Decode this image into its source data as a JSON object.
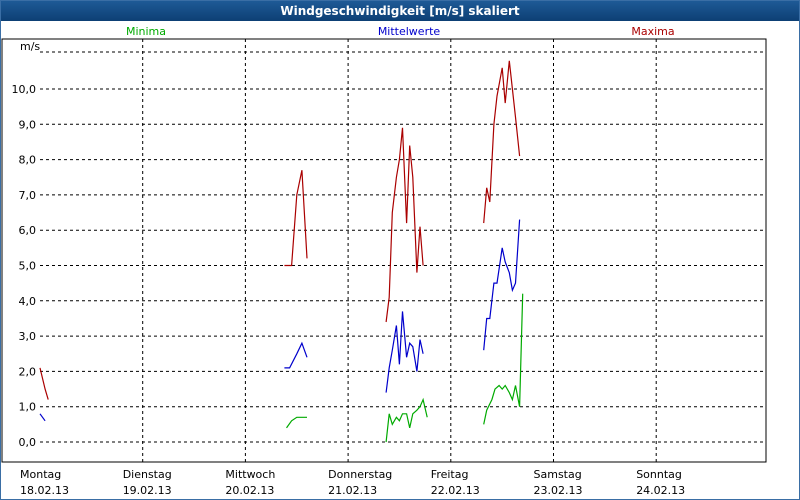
{
  "window": {
    "title": "Windgeschwindigkeit [m/s] skaliert"
  },
  "chart_data": {
    "type": "line",
    "title": "Windgeschwindigkeit [m/s] skaliert",
    "ylabel": "m/s",
    "ylim": [
      -0.6,
      11.2
    ],
    "y_ticks": [
      "0,0",
      "1,0",
      "2,0",
      "3,0",
      "4,0",
      "5,0",
      "6,0",
      "7,0",
      "8,0",
      "9,0",
      "10,0"
    ],
    "x_ticks": [
      {
        "day": "Montag",
        "date": "18.02.13"
      },
      {
        "day": "Dienstag",
        "date": "19.02.13"
      },
      {
        "day": "Mittwoch",
        "date": "20.02.13"
      },
      {
        "day": "Donnerstag",
        "date": "21.02.13"
      },
      {
        "day": "Freitag",
        "date": "22.02.13"
      },
      {
        "day": "Samstag",
        "date": "23.02.13"
      },
      {
        "day": "Sonntag",
        "date": "24.02.13"
      }
    ],
    "grid": true,
    "series": [
      {
        "name": "Minima",
        "color": "#00aa00",
        "segments": [
          [
            [
              2.4,
              0.4
            ],
            [
              2.45,
              0.6
            ],
            [
              2.5,
              0.7
            ],
            [
              2.55,
              0.7
            ],
            [
              2.6,
              0.7
            ]
          ],
          [
            [
              3.37,
              0.0
            ],
            [
              3.4,
              0.8
            ],
            [
              3.43,
              0.5
            ],
            [
              3.47,
              0.7
            ],
            [
              3.5,
              0.6
            ],
            [
              3.53,
              0.8
            ],
            [
              3.57,
              0.8
            ],
            [
              3.6,
              0.4
            ],
            [
              3.63,
              0.8
            ],
            [
              3.67,
              0.9
            ],
            [
              3.7,
              1.0
            ],
            [
              3.73,
              1.2
            ],
            [
              3.77,
              0.7
            ]
          ],
          [
            [
              4.32,
              0.5
            ],
            [
              4.35,
              0.9
            ],
            [
              4.4,
              1.2
            ],
            [
              4.43,
              1.5
            ],
            [
              4.47,
              1.6
            ],
            [
              4.5,
              1.5
            ],
            [
              4.53,
              1.6
            ],
            [
              4.57,
              1.4
            ],
            [
              4.6,
              1.2
            ],
            [
              4.63,
              1.6
            ],
            [
              4.67,
              1.0
            ],
            [
              4.7,
              4.2
            ]
          ]
        ]
      },
      {
        "name": "Mittelwerte",
        "color": "#0000cc",
        "segments": [
          [
            [
              0.0,
              0.8
            ],
            [
              0.05,
              0.6
            ]
          ],
          [
            [
              2.38,
              2.1
            ],
            [
              2.43,
              2.1
            ],
            [
              2.5,
              2.5
            ],
            [
              2.55,
              2.8
            ],
            [
              2.6,
              2.4
            ]
          ],
          [
            [
              3.37,
              1.4
            ],
            [
              3.4,
              2.1
            ],
            [
              3.43,
              2.6
            ],
            [
              3.47,
              3.3
            ],
            [
              3.5,
              2.2
            ],
            [
              3.53,
              3.7
            ],
            [
              3.57,
              2.4
            ],
            [
              3.6,
              2.8
            ],
            [
              3.63,
              2.7
            ],
            [
              3.67,
              2.0
            ],
            [
              3.7,
              2.9
            ],
            [
              3.73,
              2.5
            ]
          ],
          [
            [
              4.32,
              2.6
            ],
            [
              4.35,
              3.5
            ],
            [
              4.38,
              3.5
            ],
            [
              4.42,
              4.5
            ],
            [
              4.45,
              4.5
            ],
            [
              4.5,
              5.5
            ],
            [
              4.53,
              5.1
            ],
            [
              4.57,
              4.8
            ],
            [
              4.6,
              4.3
            ],
            [
              4.63,
              4.5
            ],
            [
              4.67,
              6.3
            ]
          ]
        ]
      },
      {
        "name": "Maxima",
        "color": "#aa0000",
        "segments": [
          [
            [
              0.0,
              2.1
            ],
            [
              0.05,
              1.5
            ],
            [
              0.08,
              1.2
            ]
          ],
          [
            [
              2.38,
              5.0
            ],
            [
              2.45,
              5.0
            ],
            [
              2.5,
              7.0
            ],
            [
              2.55,
              7.7
            ],
            [
              2.6,
              5.2
            ]
          ],
          [
            [
              3.37,
              3.4
            ],
            [
              3.4,
              4.1
            ],
            [
              3.43,
              6.5
            ],
            [
              3.47,
              7.5
            ],
            [
              3.5,
              8.0
            ],
            [
              3.53,
              8.9
            ],
            [
              3.57,
              6.2
            ],
            [
              3.6,
              8.4
            ],
            [
              3.63,
              7.5
            ],
            [
              3.67,
              4.8
            ],
            [
              3.7,
              6.1
            ],
            [
              3.73,
              5.0
            ]
          ],
          [
            [
              4.32,
              6.2
            ],
            [
              4.35,
              7.2
            ],
            [
              4.38,
              6.8
            ],
            [
              4.42,
              9.0
            ],
            [
              4.45,
              9.8
            ],
            [
              4.5,
              10.6
            ],
            [
              4.53,
              9.6
            ],
            [
              4.57,
              10.8
            ],
            [
              4.6,
              10.0
            ],
            [
              4.63,
              9.2
            ],
            [
              4.67,
              8.1
            ]
          ]
        ]
      }
    ]
  }
}
